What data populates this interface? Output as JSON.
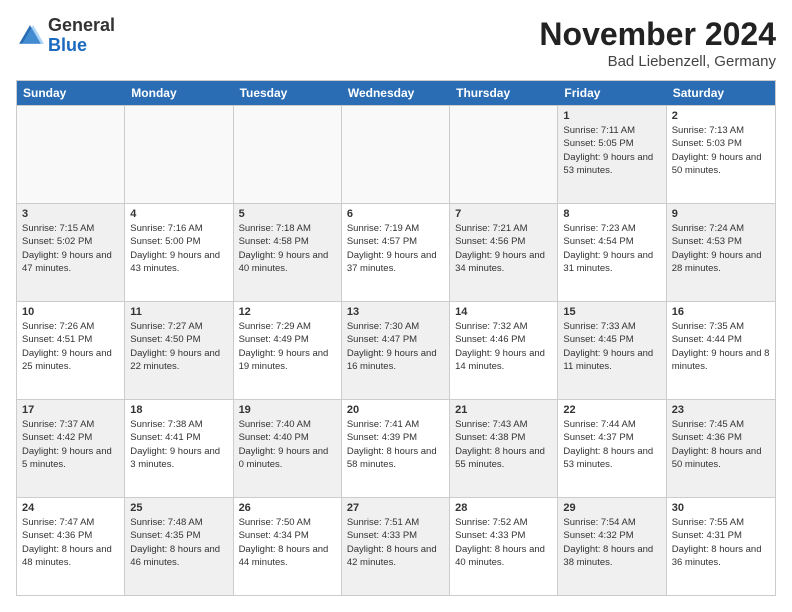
{
  "header": {
    "logo_general": "General",
    "logo_blue": "Blue",
    "month_title": "November 2024",
    "location": "Bad Liebenzell, Germany"
  },
  "weekdays": [
    "Sunday",
    "Monday",
    "Tuesday",
    "Wednesday",
    "Thursday",
    "Friday",
    "Saturday"
  ],
  "rows": [
    [
      {
        "day": "",
        "info": "",
        "empty": true
      },
      {
        "day": "",
        "info": "",
        "empty": true
      },
      {
        "day": "",
        "info": "",
        "empty": true
      },
      {
        "day": "",
        "info": "",
        "empty": true
      },
      {
        "day": "",
        "info": "",
        "empty": true
      },
      {
        "day": "1",
        "info": "Sunrise: 7:11 AM\nSunset: 5:05 PM\nDaylight: 9 hours and 53 minutes.",
        "shaded": true
      },
      {
        "day": "2",
        "info": "Sunrise: 7:13 AM\nSunset: 5:03 PM\nDaylight: 9 hours and 50 minutes.",
        "shaded": false
      }
    ],
    [
      {
        "day": "3",
        "info": "Sunrise: 7:15 AM\nSunset: 5:02 PM\nDaylight: 9 hours and 47 minutes.",
        "shaded": true
      },
      {
        "day": "4",
        "info": "Sunrise: 7:16 AM\nSunset: 5:00 PM\nDaylight: 9 hours and 43 minutes.",
        "shaded": false
      },
      {
        "day": "5",
        "info": "Sunrise: 7:18 AM\nSunset: 4:58 PM\nDaylight: 9 hours and 40 minutes.",
        "shaded": true
      },
      {
        "day": "6",
        "info": "Sunrise: 7:19 AM\nSunset: 4:57 PM\nDaylight: 9 hours and 37 minutes.",
        "shaded": false
      },
      {
        "day": "7",
        "info": "Sunrise: 7:21 AM\nSunset: 4:56 PM\nDaylight: 9 hours and 34 minutes.",
        "shaded": true
      },
      {
        "day": "8",
        "info": "Sunrise: 7:23 AM\nSunset: 4:54 PM\nDaylight: 9 hours and 31 minutes.",
        "shaded": false
      },
      {
        "day": "9",
        "info": "Sunrise: 7:24 AM\nSunset: 4:53 PM\nDaylight: 9 hours and 28 minutes.",
        "shaded": true
      }
    ],
    [
      {
        "day": "10",
        "info": "Sunrise: 7:26 AM\nSunset: 4:51 PM\nDaylight: 9 hours and 25 minutes.",
        "shaded": false
      },
      {
        "day": "11",
        "info": "Sunrise: 7:27 AM\nSunset: 4:50 PM\nDaylight: 9 hours and 22 minutes.",
        "shaded": true
      },
      {
        "day": "12",
        "info": "Sunrise: 7:29 AM\nSunset: 4:49 PM\nDaylight: 9 hours and 19 minutes.",
        "shaded": false
      },
      {
        "day": "13",
        "info": "Sunrise: 7:30 AM\nSunset: 4:47 PM\nDaylight: 9 hours and 16 minutes.",
        "shaded": true
      },
      {
        "day": "14",
        "info": "Sunrise: 7:32 AM\nSunset: 4:46 PM\nDaylight: 9 hours and 14 minutes.",
        "shaded": false
      },
      {
        "day": "15",
        "info": "Sunrise: 7:33 AM\nSunset: 4:45 PM\nDaylight: 9 hours and 11 minutes.",
        "shaded": true
      },
      {
        "day": "16",
        "info": "Sunrise: 7:35 AM\nSunset: 4:44 PM\nDaylight: 9 hours and 8 minutes.",
        "shaded": false
      }
    ],
    [
      {
        "day": "17",
        "info": "Sunrise: 7:37 AM\nSunset: 4:42 PM\nDaylight: 9 hours and 5 minutes.",
        "shaded": true
      },
      {
        "day": "18",
        "info": "Sunrise: 7:38 AM\nSunset: 4:41 PM\nDaylight: 9 hours and 3 minutes.",
        "shaded": false
      },
      {
        "day": "19",
        "info": "Sunrise: 7:40 AM\nSunset: 4:40 PM\nDaylight: 9 hours and 0 minutes.",
        "shaded": true
      },
      {
        "day": "20",
        "info": "Sunrise: 7:41 AM\nSunset: 4:39 PM\nDaylight: 8 hours and 58 minutes.",
        "shaded": false
      },
      {
        "day": "21",
        "info": "Sunrise: 7:43 AM\nSunset: 4:38 PM\nDaylight: 8 hours and 55 minutes.",
        "shaded": true
      },
      {
        "day": "22",
        "info": "Sunrise: 7:44 AM\nSunset: 4:37 PM\nDaylight: 8 hours and 53 minutes.",
        "shaded": false
      },
      {
        "day": "23",
        "info": "Sunrise: 7:45 AM\nSunset: 4:36 PM\nDaylight: 8 hours and 50 minutes.",
        "shaded": true
      }
    ],
    [
      {
        "day": "24",
        "info": "Sunrise: 7:47 AM\nSunset: 4:36 PM\nDaylight: 8 hours and 48 minutes.",
        "shaded": false
      },
      {
        "day": "25",
        "info": "Sunrise: 7:48 AM\nSunset: 4:35 PM\nDaylight: 8 hours and 46 minutes.",
        "shaded": true
      },
      {
        "day": "26",
        "info": "Sunrise: 7:50 AM\nSunset: 4:34 PM\nDaylight: 8 hours and 44 minutes.",
        "shaded": false
      },
      {
        "day": "27",
        "info": "Sunrise: 7:51 AM\nSunset: 4:33 PM\nDaylight: 8 hours and 42 minutes.",
        "shaded": true
      },
      {
        "day": "28",
        "info": "Sunrise: 7:52 AM\nSunset: 4:33 PM\nDaylight: 8 hours and 40 minutes.",
        "shaded": false
      },
      {
        "day": "29",
        "info": "Sunrise: 7:54 AM\nSunset: 4:32 PM\nDaylight: 8 hours and 38 minutes.",
        "shaded": true
      },
      {
        "day": "30",
        "info": "Sunrise: 7:55 AM\nSunset: 4:31 PM\nDaylight: 8 hours and 36 minutes.",
        "shaded": false
      }
    ]
  ]
}
